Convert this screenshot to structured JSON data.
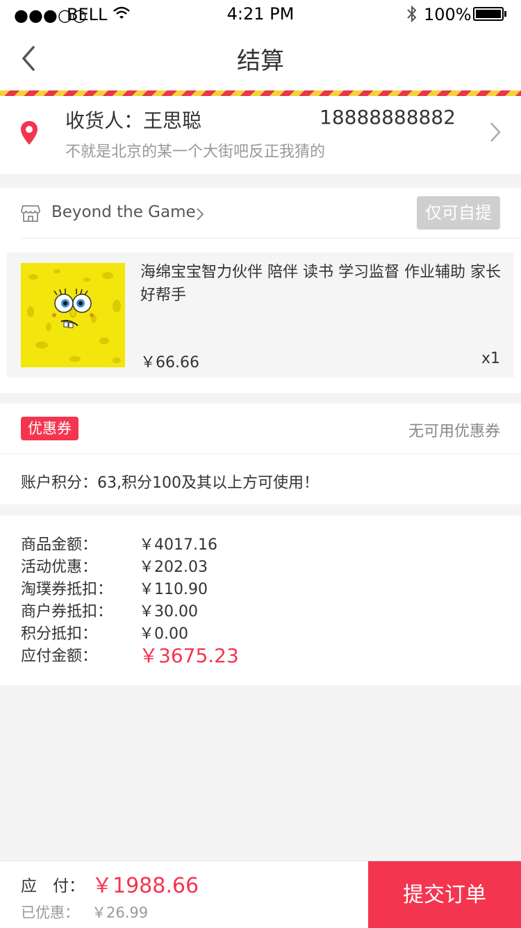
{
  "status_bar": {
    "signal": "●●●○○",
    "carrier": "BELL",
    "time": "4:21 PM",
    "battery": "100%"
  },
  "nav": {
    "title": "结算"
  },
  "address": {
    "recipient": "收货人：王思聪",
    "phone": "18888888882",
    "detail": "不就是北京的某一个大街吧反正我猜的"
  },
  "store": {
    "name": "Beyond the Game",
    "pickup_label": "仅可自提"
  },
  "product": {
    "name": "海绵宝宝智力伙伴  陪伴 读书 学习监督 作业辅助 家长好帮手",
    "price": "￥66.66",
    "quantity": "x1"
  },
  "coupon": {
    "badge": "优惠券",
    "status": "无可用优惠券",
    "points_note": "账户积分：63,积分100及其以上方可使用！"
  },
  "summary": {
    "rows": [
      {
        "label": "商品金额：",
        "value": "￥4017.16"
      },
      {
        "label": "活动优惠：",
        "value": "￥202.03"
      },
      {
        "label": "淘璞券抵扣：",
        "value": "￥110.90"
      },
      {
        "label": "商户券抵扣：",
        "value": "￥30.00"
      },
      {
        "label": "积分抵扣：",
        "value": "￥0.00"
      },
      {
        "label": "应付金额：",
        "value": "￥3675.23"
      }
    ]
  },
  "footer": {
    "pay_label": "应　付：",
    "pay_value": "￥1988.66",
    "discount_label": "已优惠：",
    "discount_value": "￥26.99",
    "submit_label": "提交订单"
  },
  "colors": {
    "accent": "#f4354f",
    "stripe_yellow": "#f5d23c",
    "stripe_red": "#e8364a"
  }
}
